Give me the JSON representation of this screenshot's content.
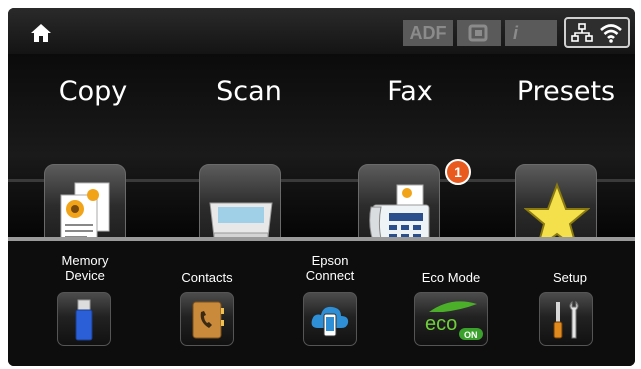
{
  "status_bar": {
    "adf_label": "ADF",
    "info_label": "i",
    "icons": [
      "home-icon",
      "adf-icon",
      "memory-card-icon",
      "info-icon",
      "network-icon",
      "wifi-icon"
    ]
  },
  "main_menu": [
    {
      "label": "Copy",
      "icon": "copy-icon"
    },
    {
      "label": "Scan",
      "icon": "scan-icon"
    },
    {
      "label": "Fax",
      "icon": "fax-icon",
      "badge": "1"
    },
    {
      "label": "Presets",
      "icon": "star-icon"
    }
  ],
  "bottom_menu": [
    {
      "label_line1": "Memory",
      "label_line2": "Device",
      "icon": "usb-drive-icon"
    },
    {
      "label_line1": "Contacts",
      "label_line2": "",
      "icon": "contacts-book-icon"
    },
    {
      "label_line1": "Epson",
      "label_line2": "Connect",
      "icon": "cloud-phone-icon"
    },
    {
      "label_line1": "Eco Mode",
      "label_line2": "",
      "icon": "eco-icon",
      "eco_text": "eco",
      "eco_state": "ON"
    },
    {
      "label_line1": "Setup",
      "label_line2": "",
      "icon": "tools-icon"
    }
  ],
  "colors": {
    "badge": "#e85a1e",
    "eco_green": "#4caf2a",
    "star": "#f3e04a"
  }
}
